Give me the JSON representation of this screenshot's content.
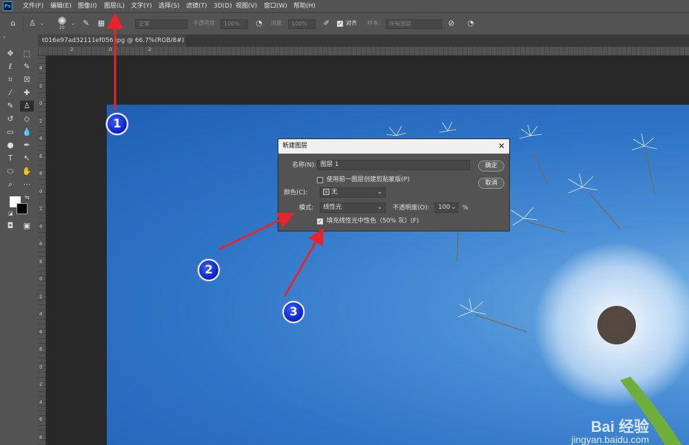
{
  "app": {
    "logo_text": "Ps"
  },
  "menu": [
    "文件(F)",
    "编辑(E)",
    "图像(I)",
    "图层(L)",
    "文字(Y)",
    "选择(S)",
    "滤镜(T)",
    "3D(D)",
    "视图(V)",
    "窗口(W)",
    "帮助(H)"
  ],
  "options_bar": {
    "brush_size": "20",
    "mode_value": "正常",
    "opacity_label": "不透明度:",
    "opacity_value": "100%",
    "flow_label": "流量:",
    "flow_value": "100%",
    "align_label": "对齐",
    "sample_label": "样本:",
    "sample_value": "所有图层"
  },
  "document_tab": {
    "label": "t016e97ad32111ef056.jpg @ 66.7%(RGB/8#) *",
    "close": "×"
  },
  "ruler": {
    "top_ticks": [
      "2",
      "0",
      "2"
    ],
    "left_ticks": [
      "4",
      "2",
      "0",
      "2",
      "4",
      "6",
      "8",
      "0",
      "2",
      "4",
      "6",
      "8",
      "0",
      "2",
      "4",
      "6",
      "8",
      "0",
      "2",
      "4",
      "6",
      "8"
    ]
  },
  "dialog": {
    "title": "新建图层",
    "close": "✕",
    "name_label": "名称(N):",
    "name_value": "图层 1",
    "clip_mask_label": "使用前一图层创建剪贴蒙版(P)",
    "clip_mask_checked": false,
    "color_label": "颜色(C):",
    "color_value": "无",
    "mode_label": "模式:",
    "mode_value": "线性光",
    "opacity_label": "不透明度(O):",
    "opacity_value": "100",
    "opacity_unit": "%",
    "fill_label": "填充线性光中性色（50% 灰）(F)",
    "fill_checked": true,
    "ok_button": "确定",
    "cancel_button": "取消"
  },
  "annotations": {
    "marker_1": "1",
    "marker_2": "2",
    "marker_3": "3"
  },
  "watermark": {
    "brand": "Bai 经验",
    "url": "jingyan.baidu.com"
  },
  "colors": {
    "accent_arrow": "#e8242a",
    "marker_blue": "#0a20c8",
    "sky": "#2f76c7"
  }
}
